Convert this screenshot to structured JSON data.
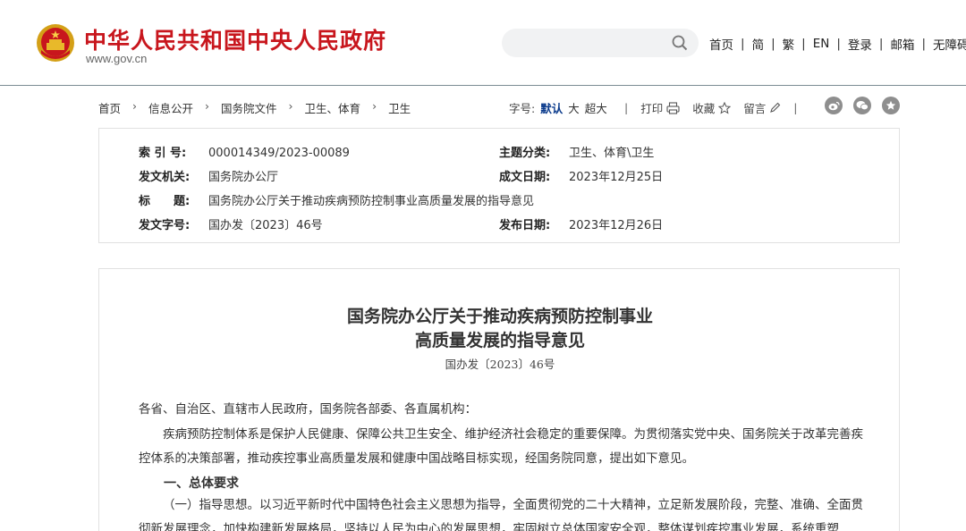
{
  "header": {
    "site_title": "中华人民共和国中央人民政府",
    "site_url": "www.gov.cn",
    "search_placeholder": "",
    "nav": [
      "首页",
      "简",
      "繁",
      "EN",
      "登录",
      "邮箱",
      "无障碍"
    ],
    "colors": {
      "brand_red": "#c8161d",
      "search_bg": "#f1f2f3"
    }
  },
  "breadcrumb": [
    "首页",
    "信息公开",
    "国务院文件",
    "卫生、体育",
    "卫生"
  ],
  "font_control": {
    "label": "字号:",
    "default": "默认",
    "large": "大",
    "xlarge": "超大"
  },
  "tools": {
    "print": "打印",
    "favorite": "收藏",
    "comment": "留言"
  },
  "share_icons": [
    "weibo-icon",
    "wechat-icon",
    "star-share-icon"
  ],
  "info": {
    "index_label": "索 引 号:",
    "index_value": "000014349/2023-00089",
    "category_label": "主题分类:",
    "category_value": "卫生、体育\\卫生",
    "issuer_label": "发文机关:",
    "issuer_value": "国务院办公厅",
    "date_label": "成文日期:",
    "date_value": "2023年12月25日",
    "title_label": "标　　题:",
    "title_value": "国务院办公厅关于推动疾病预防控制事业高质量发展的指导意见",
    "docno_label": "发文字号:",
    "docno_value": "国办发〔2023〕46号",
    "publish_label": "发布日期:",
    "publish_value": "2023年12月26日"
  },
  "document": {
    "title_line1": "国务院办公厅关于推动疾病预防控制事业",
    "title_line2": "高质量发展的指导意见",
    "doc_number": "国办发〔2023〕46号",
    "salutation": "各省、自治区、直辖市人民政府，国务院各部委、各直属机构：",
    "intro": "疾病预防控制体系是保护人民健康、保障公共卫生安全、维护经济社会稳定的重要保障。为贯彻落实党中央、国务院关于改革完善疾控体系的决策部署，推动疾控事业高质量发展和健康中国战略目标实现，经国务院同意，提出如下意见。",
    "section1": "一、总体要求",
    "para1_lead": "（一）指导思想。",
    "para1_body": "以习近平新时代中国特色社会主义思想为指导，全面贯彻党的二十大精神，立足新发展阶段，完整、准确、全面贯彻新发展理念，加快构建新发展格局，坚持以人民为中心的发展思想，牢固树立总体国家安全观，整体谋划疾控事业发展，系统重塑"
  }
}
